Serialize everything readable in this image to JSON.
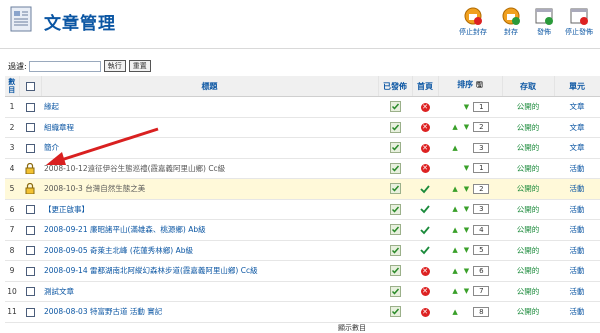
{
  "header": {
    "title": "文章管理",
    "toolbar": [
      {
        "label": "停止封存",
        "icon": "unarchive-icon"
      },
      {
        "label": "封存",
        "icon": "archive-icon"
      },
      {
        "label": "發佈",
        "icon": "publish-icon"
      },
      {
        "label": "停止發佈",
        "icon": "unpublish-icon"
      }
    ]
  },
  "filter": {
    "label": "過濾:",
    "value": "",
    "go_label": "執行",
    "reset_label": "重置"
  },
  "columns": {
    "num": "數目",
    "title": "標題",
    "published": "已發佈",
    "frontpage": "首頁",
    "order": "排序",
    "access": "存取",
    "section": "單元"
  },
  "rows": [
    {
      "num": "1",
      "title": "緣起",
      "locked": false,
      "link": true,
      "published": true,
      "frontpage": false,
      "up": false,
      "down": true,
      "order": "1",
      "access": "公開的",
      "section": "文章"
    },
    {
      "num": "2",
      "title": "組織章程",
      "locked": false,
      "link": true,
      "published": true,
      "frontpage": false,
      "up": true,
      "down": true,
      "order": "2",
      "access": "公開的",
      "section": "文章"
    },
    {
      "num": "3",
      "title": "簡介",
      "locked": false,
      "link": true,
      "published": true,
      "frontpage": false,
      "up": true,
      "down": false,
      "order": "3",
      "access": "公開的",
      "section": "文章"
    },
    {
      "num": "4",
      "title": "2008-10-12遠征伊谷生態巡禮(霞嘉義阿里山鄉) Cc級",
      "locked": true,
      "link": false,
      "published": true,
      "frontpage": false,
      "up": false,
      "down": true,
      "order": "1",
      "access": "公開的",
      "section": "活動"
    },
    {
      "num": "5",
      "title": "2008-10-3 台灣自然生態之美",
      "locked": true,
      "link": false,
      "published": true,
      "frontpage": true,
      "up": true,
      "down": true,
      "order": "2",
      "access": "公開的",
      "section": "活動"
    },
    {
      "num": "6",
      "title": "【更正啟事】",
      "locked": false,
      "link": true,
      "published": true,
      "frontpage": true,
      "up": true,
      "down": true,
      "order": "3",
      "access": "公開的",
      "section": "活動"
    },
    {
      "num": "7",
      "title": "2008-09-21 廉昭諸平山(滿雄森、桃源鄉) Ab級",
      "locked": false,
      "link": true,
      "published": true,
      "frontpage": true,
      "up": true,
      "down": true,
      "order": "4",
      "access": "公開的",
      "section": "活動"
    },
    {
      "num": "8",
      "title": "2008-09-05 奇萊主北峰 (花蓮秀林鄉) Ab級",
      "locked": false,
      "link": true,
      "published": true,
      "frontpage": true,
      "up": true,
      "down": true,
      "order": "5",
      "access": "公開的",
      "section": "活動"
    },
    {
      "num": "9",
      "title": "2008-09-14 雷都湖南北阿縱幻森林步道(霞嘉義阿里山鄉) Cc級",
      "locked": false,
      "link": true,
      "published": true,
      "frontpage": false,
      "up": true,
      "down": true,
      "order": "6",
      "access": "公開的",
      "section": "活動"
    },
    {
      "num": "10",
      "title": "測試文章",
      "locked": false,
      "link": true,
      "published": true,
      "frontpage": false,
      "up": true,
      "down": true,
      "order": "7",
      "access": "公開的",
      "section": "活動"
    },
    {
      "num": "11",
      "title": "2008-08-03 特富野古道 活動 實記",
      "locked": false,
      "link": true,
      "published": true,
      "frontpage": false,
      "up": true,
      "down": false,
      "order": "8",
      "access": "公開的",
      "section": "活動"
    }
  ],
  "footer": {
    "display_label": "顯示數目"
  },
  "colors": {
    "accent": "#0b56a3",
    "green": "#1a8a3a",
    "highlight": "#fff9d9",
    "annotation": "#d92020"
  }
}
